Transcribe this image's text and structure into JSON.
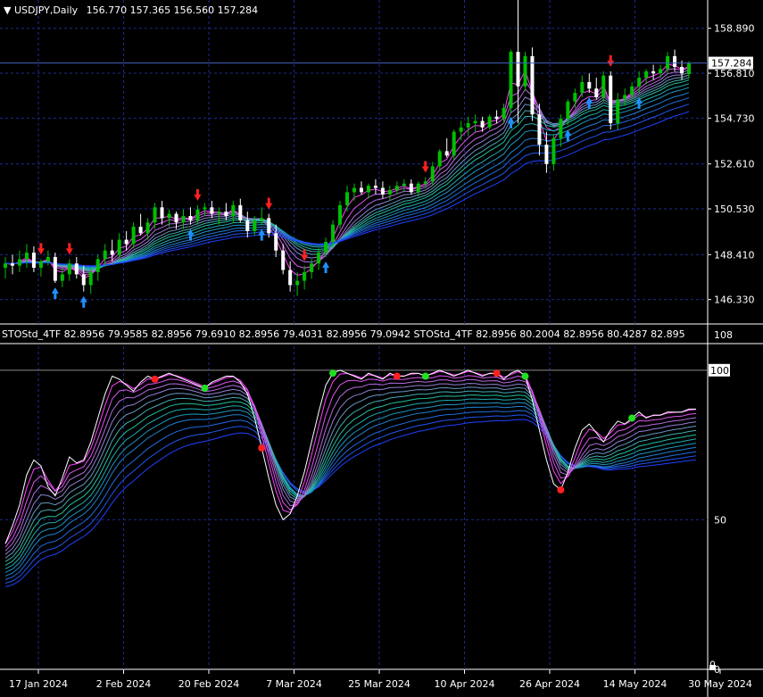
{
  "header": {
    "symbol": "USDJPY,Daily",
    "ohlc": "156.770 157.365 156.560 157.284"
  },
  "indicator_header": {
    "text": "STOStd_4TF 82.8956 79.9585 82.8956 79.6910 82.8956 79.4031 82.8956 79.0942  STOStd_4TF 82.8956 80.2004 82.8956 80.4287 82.895"
  },
  "colors": {
    "background": "#000000",
    "grid": "#1c2a8c",
    "bull_candle": "#00c000",
    "bear_candle": "#ffffff",
    "up_arrow": "#1e90ff",
    "down_arrow": "#ff2020",
    "dot_red": "#ff2020",
    "dot_green": "#20e020",
    "stoch_main": "#ffffff",
    "ribbon_fast": "#ff40ff",
    "ribbon_mid": "#20c0a0",
    "ribbon_slow": "#2040ff"
  },
  "chart_data": [
    {
      "type": "candlestick",
      "title": "USDJPY,Daily",
      "ylim": [
        145.2,
        160.2
      ],
      "price_ticks": [
        "158.890",
        "156.810",
        "154.730",
        "152.610",
        "150.530",
        "148.410",
        "146.330"
      ],
      "current_price": "157.284",
      "x_labels": [
        "17 Jan 2024",
        "2 Feb 2024",
        "20 Feb 2024",
        "7 Mar 2024",
        "25 Mar 2024",
        "10 Apr 2024",
        "26 Apr 2024",
        "14 May 2024",
        "30 May 2024"
      ],
      "candles": [
        [
          147.8,
          148.3,
          147.3,
          148.0
        ],
        [
          148.0,
          148.4,
          147.5,
          147.9
        ],
        [
          147.9,
          148.6,
          147.6,
          148.2
        ],
        [
          148.2,
          148.9,
          147.8,
          148.5
        ],
        [
          148.5,
          148.8,
          147.6,
          147.8
        ],
        [
          147.8,
          148.2,
          147.4,
          148.1
        ],
        [
          148.1,
          148.6,
          147.9,
          148.3
        ],
        [
          148.3,
          148.5,
          147.1,
          147.2
        ],
        [
          147.2,
          147.8,
          146.9,
          147.5
        ],
        [
          147.5,
          148.2,
          147.2,
          148.0
        ],
        [
          148.0,
          148.3,
          147.3,
          147.5
        ],
        [
          147.5,
          147.9,
          146.7,
          147.0
        ],
        [
          147.0,
          147.8,
          146.6,
          147.6
        ],
        [
          147.6,
          148.4,
          147.2,
          148.2
        ],
        [
          148.2,
          148.9,
          147.9,
          148.6
        ],
        [
          148.6,
          149.1,
          148.1,
          148.4
        ],
        [
          148.4,
          149.4,
          148.2,
          149.1
        ],
        [
          149.1,
          149.5,
          148.6,
          148.9
        ],
        [
          148.9,
          149.9,
          148.7,
          149.7
        ],
        [
          149.7,
          150.3,
          149.3,
          149.4
        ],
        [
          149.4,
          150.1,
          149.1,
          149.9
        ],
        [
          149.9,
          150.8,
          149.6,
          150.6
        ],
        [
          150.6,
          150.9,
          149.8,
          150.1
        ],
        [
          150.1,
          150.5,
          149.7,
          150.3
        ],
        [
          150.3,
          150.4,
          149.6,
          149.9
        ],
        [
          149.9,
          150.5,
          149.6,
          150.2
        ],
        [
          150.2,
          150.6,
          149.8,
          150.0
        ],
        [
          150.0,
          150.7,
          149.8,
          150.5
        ],
        [
          150.5,
          150.8,
          150.2,
          150.6
        ],
        [
          150.6,
          150.9,
          150.1,
          150.3
        ],
        [
          150.3,
          150.6,
          149.8,
          150.4
        ],
        [
          150.4,
          150.8,
          150.0,
          150.2
        ],
        [
          150.2,
          150.9,
          149.9,
          150.7
        ],
        [
          150.7,
          151.0,
          149.9,
          150.0
        ],
        [
          150.0,
          150.4,
          149.2,
          149.5
        ],
        [
          149.5,
          150.2,
          149.3,
          150.0
        ],
        [
          150.0,
          150.6,
          149.8,
          150.1
        ],
        [
          150.1,
          150.3,
          149.2,
          149.4
        ],
        [
          149.4,
          149.8,
          148.3,
          148.6
        ],
        [
          148.6,
          148.9,
          147.5,
          147.7
        ],
        [
          147.7,
          148.1,
          146.7,
          147.0
        ],
        [
          147.0,
          147.6,
          146.5,
          147.2
        ],
        [
          147.2,
          147.9,
          146.8,
          147.6
        ],
        [
          147.6,
          148.2,
          147.3,
          148.0
        ],
        [
          148.0,
          148.7,
          147.7,
          148.5
        ],
        [
          148.5,
          149.2,
          148.3,
          149.0
        ],
        [
          149.0,
          150.0,
          148.8,
          149.8
        ],
        [
          149.8,
          150.9,
          149.6,
          150.7
        ],
        [
          150.7,
          151.6,
          150.4,
          151.3
        ],
        [
          151.3,
          151.7,
          150.9,
          151.5
        ],
        [
          151.5,
          151.8,
          151.2,
          151.3
        ],
        [
          151.3,
          151.7,
          151.0,
          151.6
        ],
        [
          151.6,
          151.9,
          151.2,
          151.5
        ],
        [
          151.5,
          151.8,
          151.0,
          151.2
        ],
        [
          151.2,
          151.6,
          150.9,
          151.4
        ],
        [
          151.4,
          151.8,
          151.2,
          151.6
        ],
        [
          151.6,
          151.9,
          151.3,
          151.7
        ],
        [
          151.7,
          151.9,
          151.2,
          151.3
        ],
        [
          151.3,
          151.8,
          151.1,
          151.7
        ],
        [
          151.7,
          152.0,
          151.5,
          151.8
        ],
        [
          151.8,
          152.7,
          151.6,
          152.5
        ],
        [
          152.5,
          153.3,
          152.3,
          153.2
        ],
        [
          153.2,
          153.8,
          152.9,
          153.0
        ],
        [
          153.0,
          154.2,
          152.8,
          154.1
        ],
        [
          154.1,
          154.6,
          153.7,
          154.3
        ],
        [
          154.3,
          154.8,
          153.9,
          154.5
        ],
        [
          154.5,
          154.9,
          154.1,
          154.6
        ],
        [
          154.6,
          154.8,
          154.1,
          154.3
        ],
        [
          154.3,
          154.9,
          154.2,
          154.8
        ],
        [
          154.8,
          155.1,
          154.5,
          154.7
        ],
        [
          154.7,
          155.4,
          154.5,
          155.2
        ],
        [
          155.2,
          157.9,
          155.0,
          157.8
        ],
        [
          157.8,
          160.2,
          154.5,
          156.2
        ],
        [
          156.2,
          157.8,
          156.0,
          157.6
        ],
        [
          157.6,
          158.0,
          154.6,
          154.9
        ],
        [
          154.9,
          155.4,
          153.0,
          153.5
        ],
        [
          153.5,
          154.1,
          152.2,
          152.6
        ],
        [
          152.6,
          154.0,
          152.3,
          153.8
        ],
        [
          153.8,
          154.9,
          153.4,
          154.7
        ],
        [
          154.7,
          155.6,
          154.4,
          155.5
        ],
        [
          155.5,
          156.1,
          155.2,
          155.9
        ],
        [
          155.9,
          156.7,
          155.7,
          156.4
        ],
        [
          156.4,
          156.8,
          155.9,
          156.1
        ],
        [
          156.1,
          156.6,
          155.6,
          155.7
        ],
        [
          155.7,
          156.9,
          155.5,
          156.7
        ],
        [
          156.7,
          156.9,
          154.2,
          154.5
        ],
        [
          154.5,
          155.9,
          154.2,
          155.6
        ],
        [
          155.6,
          156.1,
          155.3,
          155.8
        ],
        [
          155.8,
          156.4,
          155.6,
          156.2
        ],
        [
          156.2,
          156.9,
          155.9,
          156.6
        ],
        [
          156.6,
          157.0,
          156.3,
          156.9
        ],
        [
          156.9,
          157.2,
          156.5,
          156.8
        ],
        [
          156.8,
          157.2,
          156.6,
          157.0
        ],
        [
          157.0,
          157.8,
          156.8,
          157.6
        ],
        [
          157.6,
          157.9,
          156.9,
          157.1
        ],
        [
          157.1,
          157.4,
          156.5,
          156.8
        ],
        [
          156.77,
          157.365,
          156.56,
          157.284
        ]
      ]
    },
    {
      "type": "line",
      "title": "STOStd_4TF",
      "ylim": [
        0,
        108
      ],
      "level_ticks": [
        "108",
        "100",
        "50",
        "0"
      ],
      "series": [
        {
          "values": [
            42,
            48,
            55,
            65,
            70,
            68,
            61,
            58,
            64,
            71,
            69,
            70,
            76,
            84,
            92,
            98,
            97,
            95,
            93,
            96,
            98,
            97,
            98,
            99,
            98,
            97,
            96,
            95,
            94,
            96,
            97,
            98,
            98,
            96,
            92,
            84,
            74,
            64,
            55,
            50,
            52,
            58,
            66,
            76,
            86,
            95,
            99,
            100,
            99,
            98,
            97,
            99,
            98,
            97,
            99,
            98,
            98,
            99,
            99,
            98,
            99,
            100,
            99,
            98,
            99,
            100,
            99,
            98,
            99,
            99,
            97,
            99,
            100,
            98,
            90,
            80,
            70,
            62,
            60,
            66,
            74,
            80,
            82,
            79,
            76,
            80,
            83,
            82,
            84,
            86,
            84,
            85,
            85,
            86,
            86,
            86,
            87,
            87
          ]
        }
      ]
    }
  ]
}
